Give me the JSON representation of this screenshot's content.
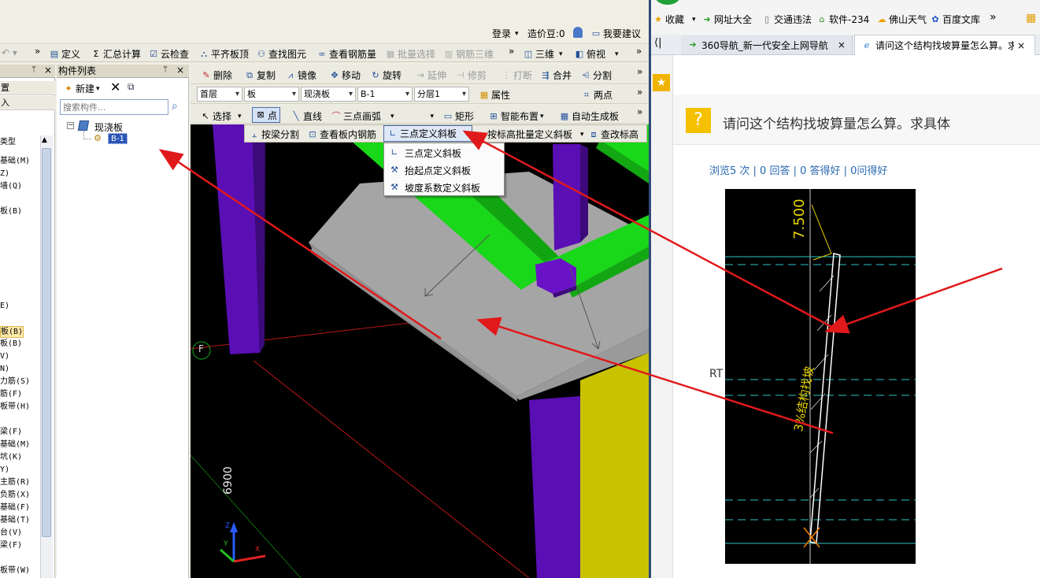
{
  "top_bar": {
    "login": "登录",
    "cost_beans": "造价豆:0",
    "suggest": "我要建议"
  },
  "main_toolbar": [
    {
      "label": "定义"
    },
    {
      "label": "汇总计算"
    },
    {
      "label": "云检查"
    },
    {
      "label": "平齐板顶"
    },
    {
      "label": "查找图元"
    },
    {
      "label": "查看钢筋量"
    },
    {
      "label": "批量选择"
    },
    {
      "label": "钢筋三维"
    },
    {
      "label": "三维"
    },
    {
      "label": "俯视"
    }
  ],
  "edit_toolbar": [
    {
      "label": "删除"
    },
    {
      "label": "复制"
    },
    {
      "label": "镜像"
    },
    {
      "label": "移动"
    },
    {
      "label": "旋转"
    },
    {
      "label": "延伸"
    },
    {
      "label": "修剪"
    },
    {
      "label": "打断"
    },
    {
      "label": "合并"
    },
    {
      "label": "分割"
    }
  ],
  "filters": {
    "floor": "首层",
    "type": "板",
    "subtype": "现浇板",
    "name": "B-1",
    "layer": "分层1",
    "properties": "属性",
    "two_points": "两点"
  },
  "draw_toolbar": [
    {
      "label": "选择"
    },
    {
      "label": "点"
    },
    {
      "label": "直线"
    },
    {
      "label": "三点画弧"
    },
    {
      "label": "矩形"
    },
    {
      "label": "智能布置"
    },
    {
      "label": "自动生成板"
    }
  ],
  "slab_toolbar": [
    {
      "label": "按梁分割"
    },
    {
      "label": "查看板内钢筋"
    },
    {
      "label": "三点定义斜板"
    },
    {
      "label": "按标高批量定义斜板"
    },
    {
      "label": "查改标高"
    }
  ],
  "slope_menu": [
    {
      "label": "三点定义斜板"
    },
    {
      "label": "抬起点定义斜板"
    },
    {
      "label": "坡度系数定义斜板"
    }
  ],
  "left_panel": {
    "header_items": [
      "置",
      "入"
    ],
    "items": [
      "类型",
      "基础(M)",
      "Z)",
      "墙(Q)",
      "板(B)",
      "E)",
      "板(B)",
      "板(B)",
      "V)",
      "N)",
      "力筋(S)",
      "筋(F)",
      "板带(H)",
      "梁(F)",
      "基础(M)",
      "坑(K)",
      "Y)",
      "主筋(R)",
      "负筋(X)",
      "基础(F)",
      "基础(T)",
      "台(V)",
      "梁(F)",
      "板带(W)"
    ]
  },
  "component_panel": {
    "title": "构件列表",
    "new_button": "新建",
    "search_placeholder": "搜索构件...",
    "tree_root": "现浇板",
    "tree_child": "B-1"
  },
  "viewport": {
    "axis_label": "F",
    "dimension": "6900"
  },
  "browser": {
    "favorites": "收藏",
    "bookmarks": [
      {
        "label": "网址大全"
      },
      {
        "label": "交通违法"
      },
      {
        "label": "软件-234"
      },
      {
        "label": "佛山天气"
      },
      {
        "label": "百度文库"
      }
    ],
    "tabs": [
      {
        "label": "360导航_新一代安全上网导航"
      },
      {
        "label": "请问这个结构找坡算量怎么算。求具体"
      }
    ],
    "question_title": "请问这个结构找坡算量怎么算。求具体",
    "stats": "浏览5 次 | 0 回答 | 0 答得好 | 0问得好",
    "drawing": {
      "elevation": "7.500",
      "side_label": "RT",
      "slope_text": "3%结构找坡"
    }
  },
  "colors": {
    "arrow": "#e0191b",
    "column": "#6a12c8",
    "beam": "#19d719",
    "slab": "#a9a9a9",
    "yellow_col": "#c8c200"
  }
}
